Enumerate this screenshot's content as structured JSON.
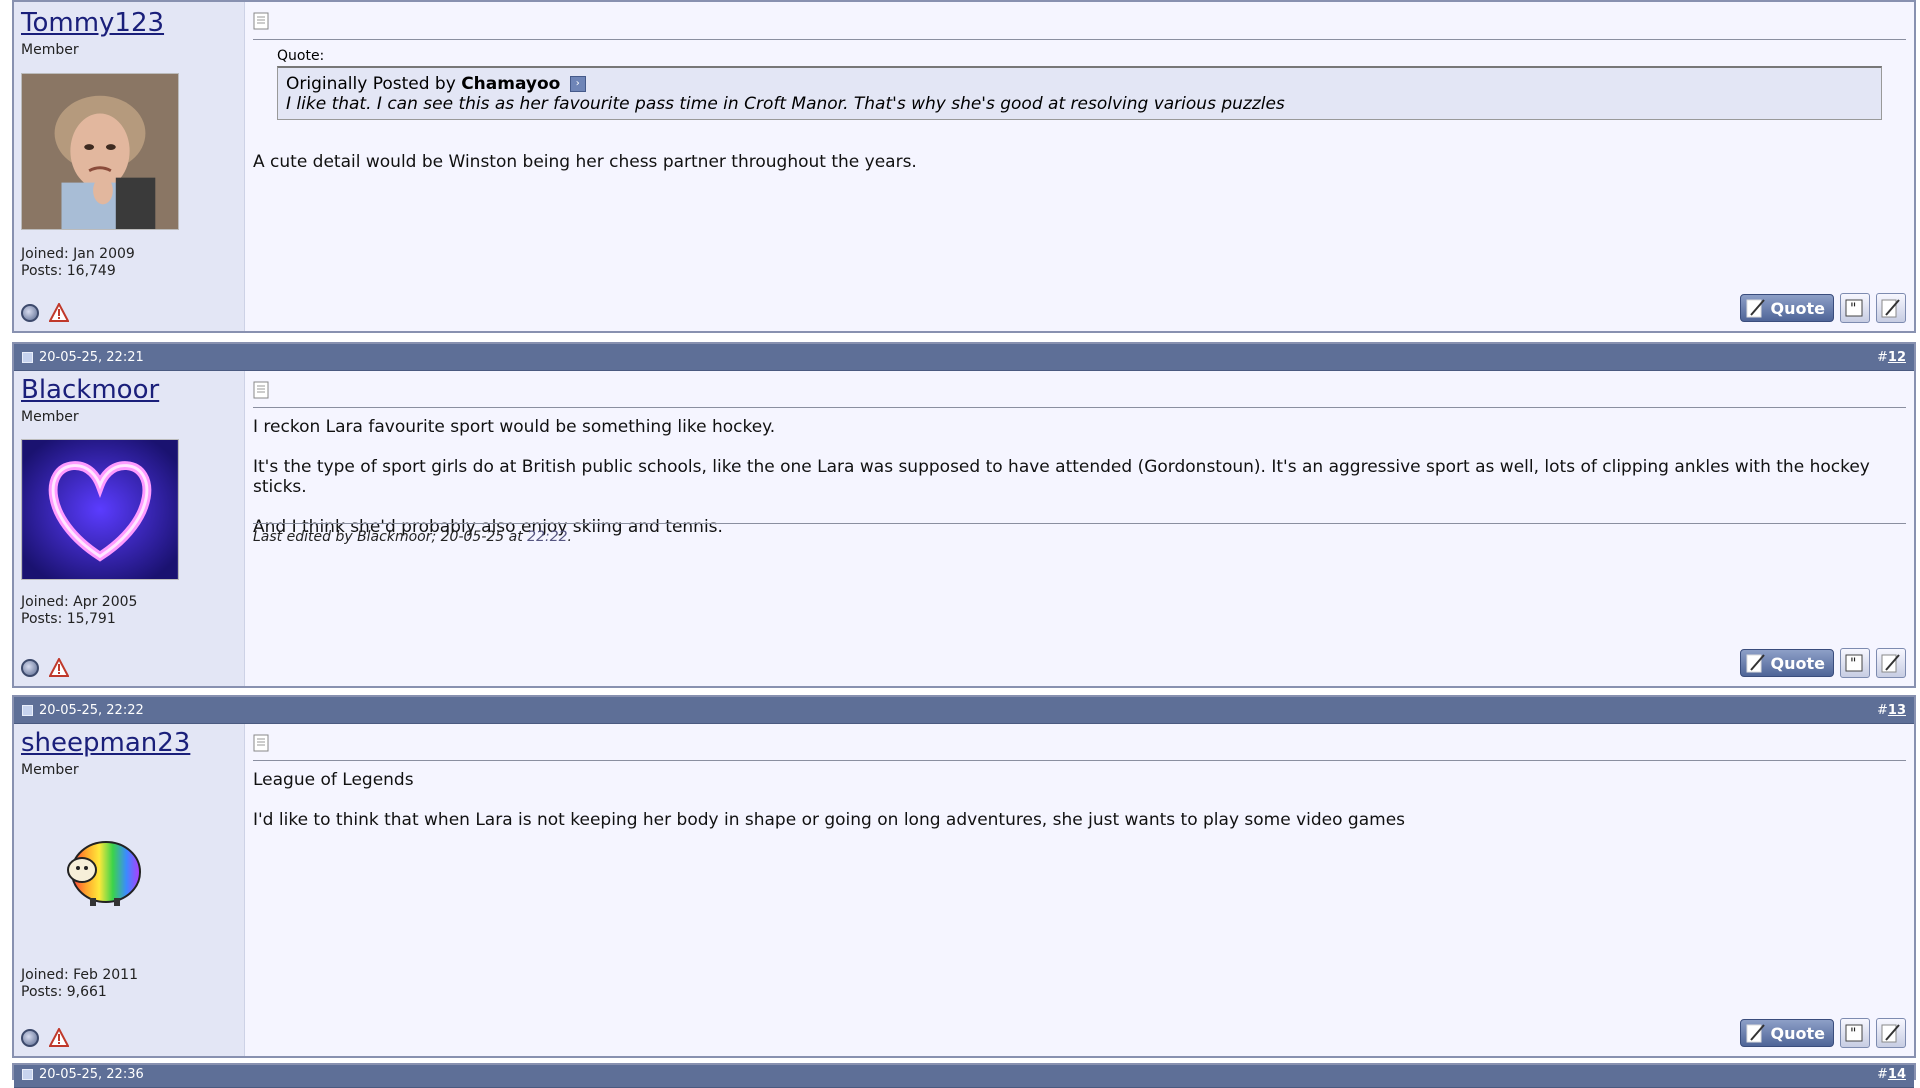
{
  "posts": [
    {
      "username": "Tommy123",
      "role": "Member",
      "joined": "Joined: Jan 2009",
      "posts": "Posts: 16,749",
      "quote": {
        "label": "Quote:",
        "originally_prefix": "Originally Posted by",
        "author": "Chamayoo",
        "text": "I like that. I can see this as her favourite pass time in Croft Manor. That's why she's good at resolving various puzzles"
      },
      "paragraphs": [
        "A cute detail would be Winston being her chess partner throughout the years."
      ],
      "quote_button": "Quote"
    },
    {
      "date": "20-05-25, 22:21",
      "number_prefix": "#",
      "number": "12",
      "username": "Blackmoor",
      "role": "Member",
      "joined": "Joined: Apr 2005",
      "posts": "Posts: 15,791",
      "paragraphs": [
        "I reckon Lara favourite sport would be something like hockey.",
        "It's the type of sport girls do at British public schools, like the one Lara was supposed to have attended (Gordonstoun). It's an aggressive sport as well, lots of clipping ankles with the hockey sticks.",
        "And I think she'd probably also enjoy skiing and tennis."
      ],
      "edited_prefix": "Last edited by Blackmoor; 20-05-25 at",
      "edited_time": "22:22",
      "edited_suffix": ".",
      "quote_button": "Quote"
    },
    {
      "date": "20-05-25, 22:22",
      "number_prefix": "#",
      "number": "13",
      "username": "sheepman23",
      "role": "Member",
      "joined": "Joined: Feb 2011",
      "posts": "Posts: 9,661",
      "paragraphs": [
        "League of Legends",
        "I'd like to think that when Lara is not keeping her body in shape or going on long adventures, she just wants to play some video games"
      ],
      "quote_button": "Quote"
    },
    {
      "date": "20-05-25, 22:36",
      "number_prefix": "#",
      "number": "14"
    }
  ],
  "colors": {
    "header_bar": "#5e6f97",
    "user_column": "#e3e6f5",
    "message_bg": "#f5f5ff",
    "username_link": "#1a1f7a"
  },
  "icons": [
    "post-icon",
    "document-icon",
    "online-status-icon",
    "report-post-icon",
    "quote-icon",
    "multi-quote-icon",
    "quick-reply-icon",
    "view-post-icon"
  ]
}
